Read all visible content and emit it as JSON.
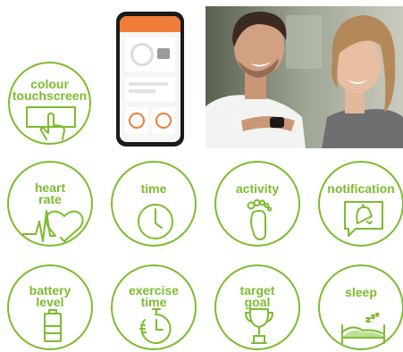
{
  "accent_color": "#7dbb2f",
  "brand_orange": "#f07c3a",
  "features": [
    {
      "label": "colour\ntouchscreen",
      "icon": "touch-screen-icon"
    },
    {
      "label": "heart\nrate",
      "icon": "heart-rate-icon"
    },
    {
      "label": "time",
      "icon": "clock-icon"
    },
    {
      "label": "activity",
      "icon": "footprint-icon"
    },
    {
      "label": "notification",
      "icon": "notification-bell-icon"
    },
    {
      "label": "battery\nlevel",
      "icon": "battery-icon"
    },
    {
      "label": "exercise\ntime",
      "icon": "stopwatch-icon"
    },
    {
      "label": "target\ngoal",
      "icon": "trophy-icon"
    },
    {
      "label": "sleep",
      "icon": "bed-icon"
    }
  ],
  "phone": {
    "icon": "smartphone-app-image"
  },
  "photo": {
    "icon": "couple-photo-image"
  }
}
